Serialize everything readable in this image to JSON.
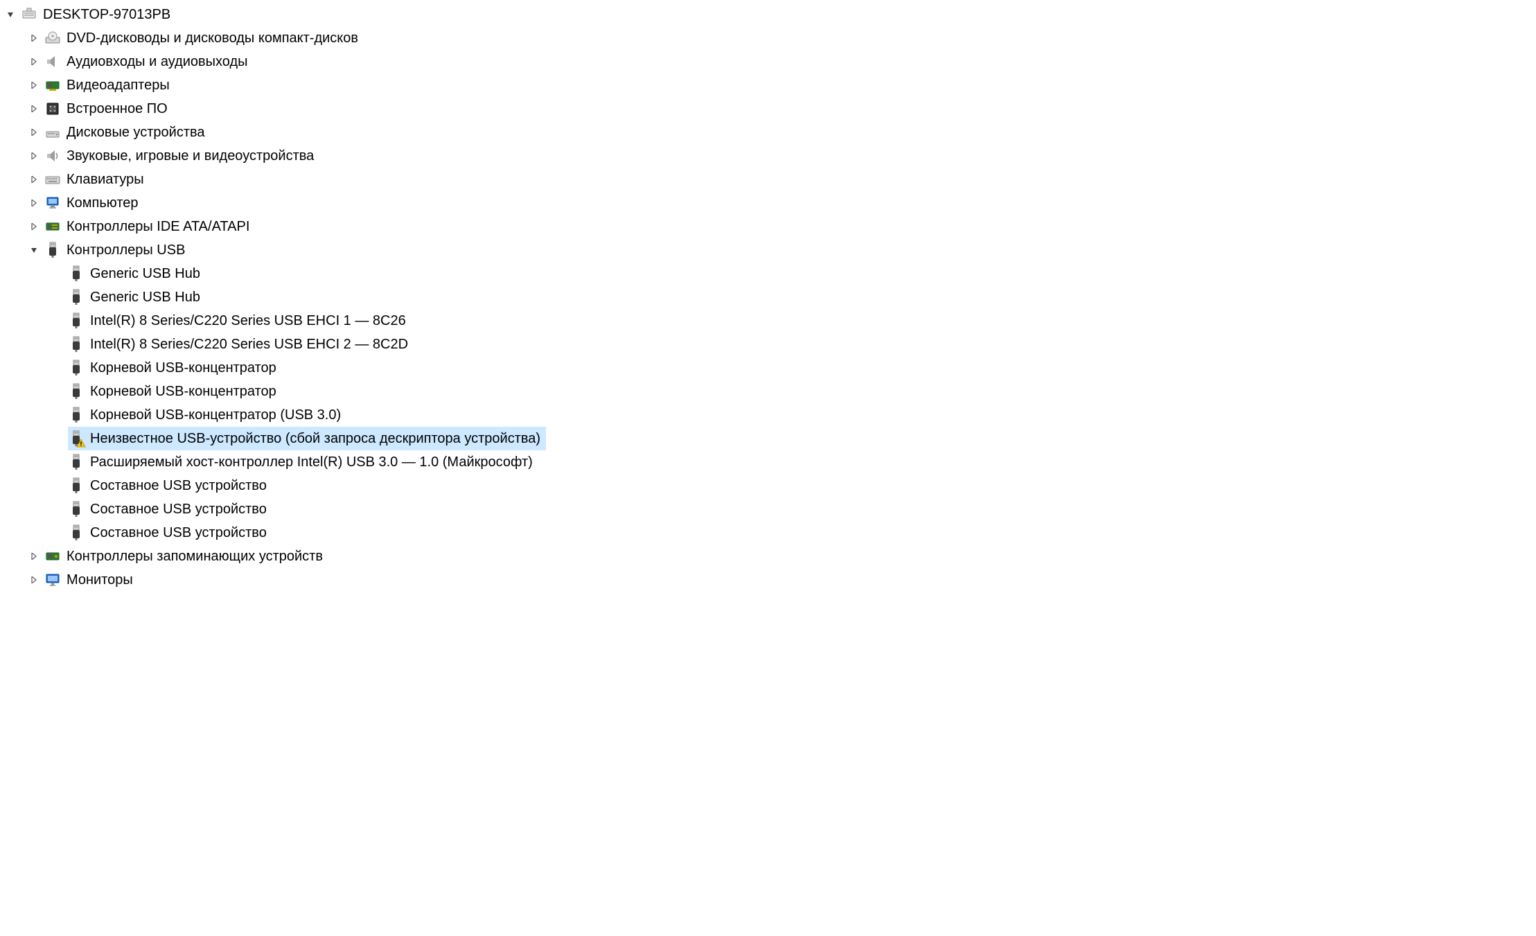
{
  "tree": {
    "root": {
      "label": "DESKTOP-97013PB",
      "expanded": true,
      "icon": "computer-root-icon"
    },
    "categories": [
      {
        "label": "DVD-дисководы и дисководы компакт-дисков",
        "icon": "dvd-drive-icon",
        "expanded": false
      },
      {
        "label": "Аудиовходы и аудиовыходы",
        "icon": "audio-io-icon",
        "expanded": false
      },
      {
        "label": "Видеоадаптеры",
        "icon": "display-adapter-icon",
        "expanded": false
      },
      {
        "label": "Встроенное ПО",
        "icon": "firmware-icon",
        "expanded": false
      },
      {
        "label": "Дисковые устройства",
        "icon": "disk-drive-icon",
        "expanded": false
      },
      {
        "label": "Звуковые, игровые и видеоустройства",
        "icon": "sound-controller-icon",
        "expanded": false
      },
      {
        "label": "Клавиатуры",
        "icon": "keyboard-icon",
        "expanded": false
      },
      {
        "label": "Компьютер",
        "icon": "computer-icon",
        "expanded": false
      },
      {
        "label": "Контроллеры IDE ATA/ATAPI",
        "icon": "ide-controller-icon",
        "expanded": false
      },
      {
        "label": "Контроллеры USB",
        "icon": "usb-controller-icon",
        "expanded": true,
        "children": [
          {
            "label": "Generic USB Hub",
            "icon": "usb-device-icon",
            "warning": false
          },
          {
            "label": "Generic USB Hub",
            "icon": "usb-device-icon",
            "warning": false
          },
          {
            "label": "Intel(R) 8 Series/C220 Series USB EHCI 1 — 8C26",
            "icon": "usb-device-icon",
            "warning": false
          },
          {
            "label": "Intel(R) 8 Series/C220 Series USB EHCI 2 — 8C2D",
            "icon": "usb-device-icon",
            "warning": false
          },
          {
            "label": "Корневой USB-концентратор",
            "icon": "usb-device-icon",
            "warning": false
          },
          {
            "label": "Корневой USB-концентратор",
            "icon": "usb-device-icon",
            "warning": false
          },
          {
            "label": "Корневой USB-концентратор (USB 3.0)",
            "icon": "usb-device-icon",
            "warning": false
          },
          {
            "label": "Неизвестное USB-устройство (сбой запроса дескриптора устройства)",
            "icon": "usb-device-icon",
            "warning": true,
            "selected": true
          },
          {
            "label": "Расширяемый хост-контроллер Intel(R) USB 3.0 — 1.0 (Майкрософт)",
            "icon": "usb-device-icon",
            "warning": false
          },
          {
            "label": "Составное USB устройство",
            "icon": "usb-device-icon",
            "warning": false
          },
          {
            "label": "Составное USB устройство",
            "icon": "usb-device-icon",
            "warning": false
          },
          {
            "label": "Составное USB устройство",
            "icon": "usb-device-icon",
            "warning": false
          }
        ]
      },
      {
        "label": "Контроллеры запоминающих устройств",
        "icon": "storage-controller-icon",
        "expanded": false
      },
      {
        "label": "Мониторы",
        "icon": "monitor-icon",
        "expanded": false
      }
    ]
  },
  "colors": {
    "selection": "#cde8ff",
    "expander": "#6d6d6d",
    "expander_expanded": "#404040"
  }
}
